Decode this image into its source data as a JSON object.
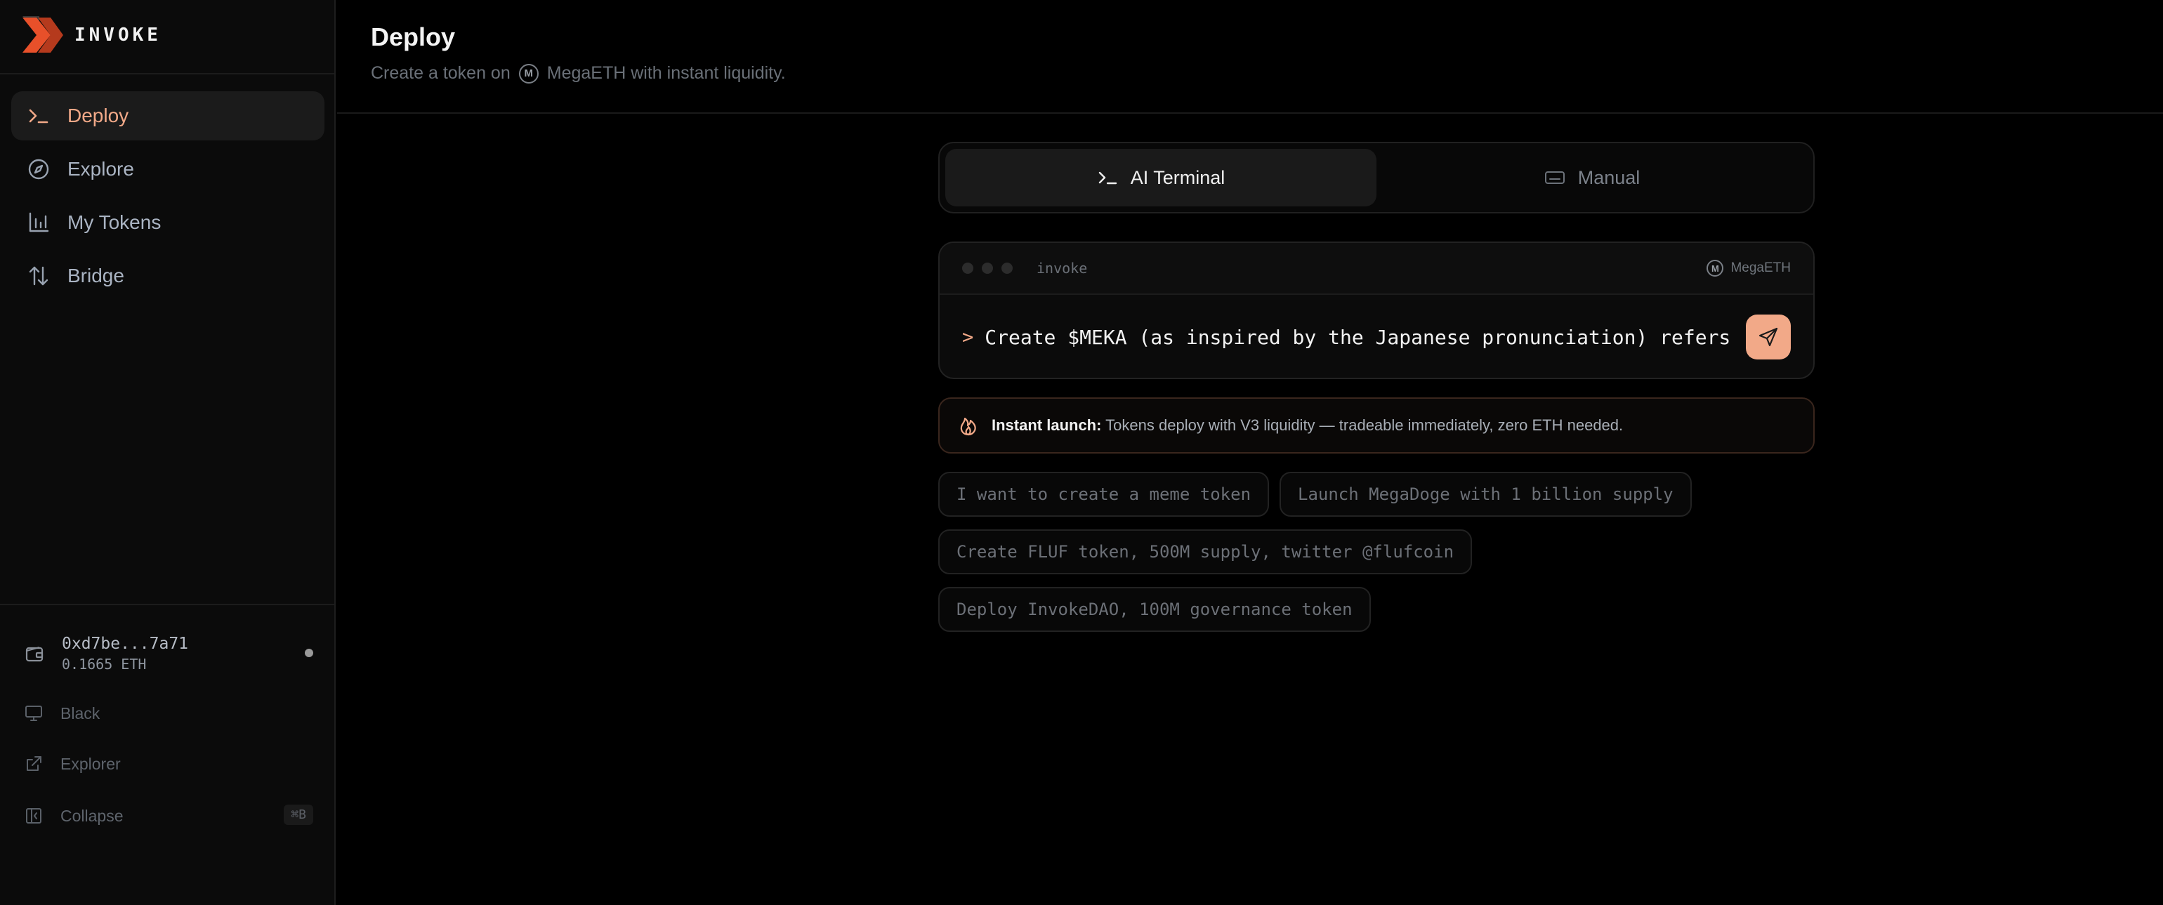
{
  "brand": {
    "name": "INVOKE",
    "accent": "#e8502a"
  },
  "sidebar": {
    "items": [
      {
        "label": "Deploy",
        "icon": "terminal-icon",
        "active": true
      },
      {
        "label": "Explore",
        "icon": "compass-icon",
        "active": false
      },
      {
        "label": "My Tokens",
        "icon": "bar-chart-icon",
        "active": false
      },
      {
        "label": "Bridge",
        "icon": "arrows-up-down-icon",
        "active": false
      }
    ],
    "wallet": {
      "address": "0xd7be...7a71",
      "balance": "0.1665 ETH"
    },
    "theme_label": "Black",
    "explorer_label": "Explorer",
    "collapse_label": "Collapse",
    "collapse_shortcut": "⌘B"
  },
  "header": {
    "title": "Deploy",
    "subtitle_before": "Create a token on",
    "network_badge": "M",
    "subtitle_after": "MegaETH with instant liquidity."
  },
  "tabs": [
    {
      "label": "AI Terminal",
      "active": true
    },
    {
      "label": "Manual",
      "active": false
    }
  ],
  "terminal": {
    "name": "invoke",
    "network": "MegaETH",
    "network_badge": "M",
    "prompt": ">",
    "input_value": "Create $MEKA (as inspired by the Japanese pronunciation) refers"
  },
  "banner": {
    "title": "Instant launch:",
    "text": "Tokens deploy with V3 liquidity — tradeable immediately, zero ETH needed."
  },
  "suggestions": [
    "I want to create a meme token",
    "Launch MegaDoge with 1 billion supply",
    "Create FLUF token, 500M supply, twitter @flufcoin",
    "Deploy InvokeDAO, 100M governance token"
  ],
  "colors": {
    "accent": "#f2a988",
    "background": "#000000",
    "sidebar": "#0b0b0b"
  }
}
